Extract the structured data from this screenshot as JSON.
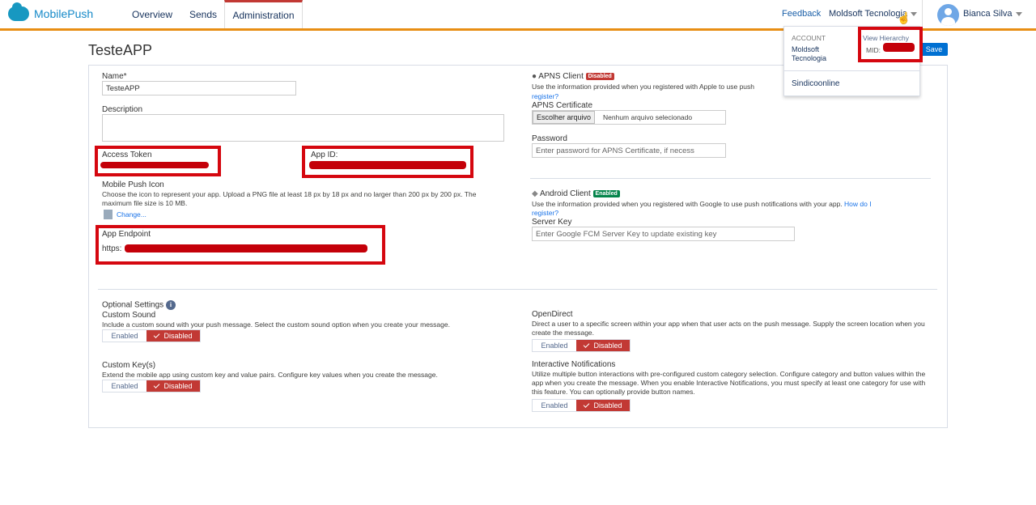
{
  "brand": {
    "name": "MobilePush"
  },
  "nav": {
    "overview": "Overview",
    "sends": "Sends",
    "administration": "Administration"
  },
  "header": {
    "feedback": "Feedback",
    "account_name": "Moldsoft Tecnologia",
    "user_name": "Bianca Silva"
  },
  "account_menu": {
    "account_heading": "ACCOUNT",
    "view_hierarchy": "View Hierarchy",
    "account_name": "Moldsoft Tecnologia",
    "mid_label": "MID:",
    "other_account": "Sindicoonline"
  },
  "page": {
    "title": "TesteAPP",
    "save": "Save"
  },
  "form": {
    "name_label": "Name*",
    "name_value": "TesteAPP",
    "description_label": "Description",
    "access_token_label": "Access Token",
    "app_id_label": "App ID:",
    "icon_label": "Mobile Push Icon",
    "icon_help": "Choose the icon to represent your app. Upload a PNG file at least 18 px by 18 px and no larger than 200 px by 200 px. The maximum file size is 10 MB.",
    "icon_change": "Change...",
    "endpoint_label": "App Endpoint",
    "endpoint_prefix": "https:"
  },
  "apns": {
    "title": "APNS Client",
    "badge": "Disabled",
    "help": "Use the information provided when you registered with Apple to use push",
    "register_link": "register?",
    "cert_label": "APNS Certificate",
    "file_button": "Escolher arquivo",
    "file_status": "Nenhum arquivo selecionado",
    "password_label": "Password",
    "password_placeholder": "Enter password for APNS Certificate, if necess"
  },
  "android": {
    "title": "Android Client",
    "badge": "Enabled",
    "help": "Use the information provided when you registered with Google to use push notifications with your app.",
    "how_link": "How do I",
    "register_link": "register?",
    "server_key_label": "Server Key",
    "server_key_placeholder": "Enter Google FCM Server Key to update existing key"
  },
  "optional": {
    "heading": "Optional Settings",
    "info_icon": "i",
    "custom_sound_label": "Custom Sound",
    "custom_sound_help": "Include a custom sound with your push message. Select the custom sound option when you create your message.",
    "custom_keys_label": "Custom Key(s)",
    "custom_keys_help": "Extend the mobile app using custom key and value pairs. Configure key values when you create the message.",
    "opendirect_label": "OpenDirect",
    "opendirect_help": "Direct a user to a specific screen within your app when that user acts on the push message. Supply the screen location when you create the message.",
    "interactive_label": "Interactive Notifications",
    "interactive_help": "Utilize multiple button interactions with pre-configured custom category selection. Configure category and button values within the app when you create the message. When you enable Interactive Notifications, you must specify at least one category for use with this feature. You can optionally provide button names.",
    "enabled": "Enabled",
    "disabled": "Disabled"
  },
  "colors": {
    "accent_orange": "#e88e14",
    "disabled_red": "#c23934",
    "enabled_green": "#04844b",
    "link_blue": "#1a73e8",
    "save_blue": "#0070d2"
  }
}
